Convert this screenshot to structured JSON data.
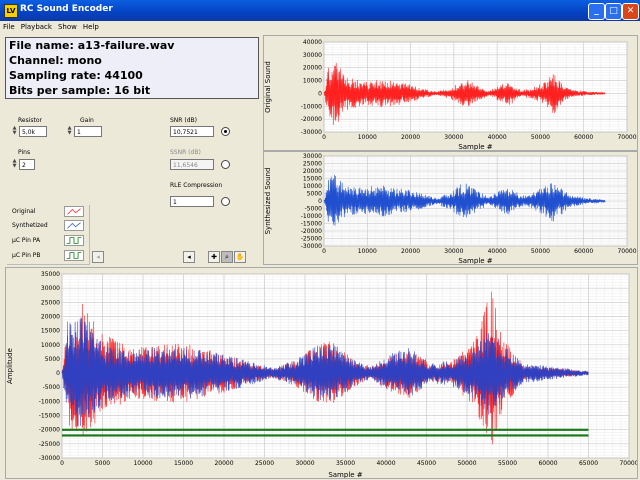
{
  "window": {
    "title": "RC Sound Encoder",
    "app_icon": "LV",
    "minimize": "_",
    "maximize": "□",
    "close": "✕"
  },
  "menu": [
    "File",
    "Playback",
    "Show",
    "Help"
  ],
  "info": {
    "file_name": "File name: a13-failure.wav",
    "channel": "Channel: mono",
    "sampling_rate": "Sampling rate: 44100",
    "bits": "Bits per sample: 16 bit"
  },
  "controls": {
    "resistor_label": "Resistor",
    "resistor_value": "5,0k",
    "gain_label": "Gain",
    "gain_value": "1",
    "pins_label": "Pins",
    "pins_value": "2",
    "snr_label": "SNR (dB)",
    "snr_value": "10,7521",
    "ssnr_label": "SSNR (dB)",
    "ssnr_value": "11,6546",
    "rle_label": "RLE Compression",
    "rle_value": "1"
  },
  "legend": [
    {
      "label": "Original",
      "swatch": "line",
      "color": "#ff3030"
    },
    {
      "label": "Synthetized",
      "swatch": "line",
      "color": "#4060c0"
    },
    {
      "label": "µC Pin PA",
      "swatch": "square",
      "color": "#1a7a1a"
    },
    {
      "label": "µC Pin PB",
      "swatch": "square",
      "color": "#1a7a1a"
    }
  ],
  "tools": [
    "cursor-icon",
    "zoom-icon",
    "pan-icon"
  ],
  "chart_data": [
    {
      "type": "line",
      "ylabel": "Original Sound",
      "xlabel": "Sample #",
      "xlim": [
        0,
        70000
      ],
      "ylim": [
        -30000,
        40000
      ],
      "x_ticks": [
        0,
        10000,
        20000,
        30000,
        40000,
        50000,
        60000,
        70000
      ],
      "y_ticks": [
        -30000,
        -20000,
        -10000,
        0,
        10000,
        20000,
        30000,
        40000
      ],
      "series": [
        {
          "color": "#ff2020",
          "envelope": [
            [
              0,
              0
            ],
            [
              1000,
              20000
            ],
            [
              2500,
              26000
            ],
            [
              5000,
              14000
            ],
            [
              9000,
              9000
            ],
            [
              13000,
              11000
            ],
            [
              16000,
              10000
            ],
            [
              20000,
              7000
            ],
            [
              23000,
              4000
            ],
            [
              26000,
              1500
            ],
            [
              29000,
              4000
            ],
            [
              31500,
              9000
            ],
            [
              33000,
              11500
            ],
            [
              36000,
              5000
            ],
            [
              38000,
              2000
            ],
            [
              41000,
              7000
            ],
            [
              43000,
              9000
            ],
            [
              45500,
              3000
            ],
            [
              48000,
              4000
            ],
            [
              51000,
              9000
            ],
            [
              53000,
              17000
            ],
            [
              54500,
              10000
            ],
            [
              57000,
              3000
            ],
            [
              60000,
              2000
            ],
            [
              65000,
              500
            ]
          ]
        }
      ]
    },
    {
      "type": "line",
      "ylabel": "Synthesized Sound",
      "xlabel": "Sample #",
      "xlim": [
        0,
        70000
      ],
      "ylim": [
        -30000,
        30000
      ],
      "x_ticks": [
        0,
        10000,
        20000,
        30000,
        40000,
        50000,
        60000,
        70000
      ],
      "y_ticks": [
        -30000,
        -25000,
        -20000,
        -15000,
        -10000,
        -5000,
        0,
        5000,
        10000,
        15000,
        20000,
        25000,
        30000
      ],
      "series": [
        {
          "color": "#2050d0",
          "envelope": [
            [
              0,
              0
            ],
            [
              1000,
              16000
            ],
            [
              2500,
              18000
            ],
            [
              5000,
              10000
            ],
            [
              9000,
              9000
            ],
            [
              13000,
              11000
            ],
            [
              16000,
              9000
            ],
            [
              20000,
              7500
            ],
            [
              23000,
              5000
            ],
            [
              26000,
              2000
            ],
            [
              29000,
              6000
            ],
            [
              31500,
              11000
            ],
            [
              33000,
              12000
            ],
            [
              36000,
              6000
            ],
            [
              38000,
              3000
            ],
            [
              41000,
              8000
            ],
            [
              43000,
              9500
            ],
            [
              45500,
              4000
            ],
            [
              48000,
              5000
            ],
            [
              51000,
              10000
            ],
            [
              53000,
              14000
            ],
            [
              54500,
              10000
            ],
            [
              57000,
              4000
            ],
            [
              60000,
              2500
            ],
            [
              65000,
              800
            ]
          ]
        }
      ]
    },
    {
      "type": "line",
      "ylabel": "Amplitude",
      "xlabel": "Sample #",
      "xlim": [
        0,
        70000
      ],
      "ylim": [
        -30000,
        35000
      ],
      "x_ticks": [
        0,
        5000,
        10000,
        15000,
        20000,
        25000,
        30000,
        35000,
        40000,
        45000,
        50000,
        55000,
        60000,
        65000,
        70000
      ],
      "y_ticks": [
        -30000,
        -25000,
        -20000,
        -15000,
        -10000,
        -5000,
        0,
        5000,
        10000,
        15000,
        20000,
        25000,
        30000,
        35000
      ],
      "series": [
        {
          "name": "Original",
          "color": "#ff2020",
          "envelope": [
            [
              0,
              0
            ],
            [
              800,
              22000
            ],
            [
              2500,
              25000
            ],
            [
              5000,
              14000
            ],
            [
              9000,
              9000
            ],
            [
              13000,
              11000
            ],
            [
              16000,
              10000
            ],
            [
              20000,
              7000
            ],
            [
              23000,
              4000
            ],
            [
              26000,
              1500
            ],
            [
              29000,
              5000
            ],
            [
              31500,
              10000
            ],
            [
              33000,
              12000
            ],
            [
              36000,
              5000
            ],
            [
              38000,
              2000
            ],
            [
              41000,
              7000
            ],
            [
              43000,
              9000
            ],
            [
              45500,
              3000
            ],
            [
              48000,
              4000
            ],
            [
              51000,
              12000
            ],
            [
              53000,
              30000
            ],
            [
              54500,
              12000
            ],
            [
              57000,
              3000
            ],
            [
              60000,
              2000
            ],
            [
              65000,
              500
            ]
          ]
        },
        {
          "name": "Synthetized",
          "color": "#3040c0",
          "envelope": [
            [
              0,
              0
            ],
            [
              800,
              18000
            ],
            [
              2500,
              20000
            ],
            [
              5000,
              11000
            ],
            [
              9000,
              8000
            ],
            [
              13000,
              10000
            ],
            [
              16000,
              9000
            ],
            [
              20000,
              7000
            ],
            [
              23000,
              4500
            ],
            [
              26000,
              1800
            ],
            [
              29000,
              5000
            ],
            [
              31500,
              10000
            ],
            [
              33000,
              11000
            ],
            [
              36000,
              5000
            ],
            [
              38000,
              2500
            ],
            [
              41000,
              7500
            ],
            [
              43000,
              9000
            ],
            [
              45500,
              3500
            ],
            [
              48000,
              4500
            ],
            [
              51000,
              10000
            ],
            [
              53000,
              16000
            ],
            [
              54500,
              10000
            ],
            [
              57000,
              3500
            ],
            [
              60000,
              2500
            ],
            [
              65000,
              700
            ]
          ]
        },
        {
          "name": "µC Pin PA",
          "color": "#1a7a1a",
          "constant": -20000,
          "x_range": [
            0,
            65000
          ]
        },
        {
          "name": "µC Pin PB",
          "color": "#1a7a1a",
          "constant": -22000,
          "x_range": [
            0,
            65000
          ]
        }
      ]
    }
  ]
}
